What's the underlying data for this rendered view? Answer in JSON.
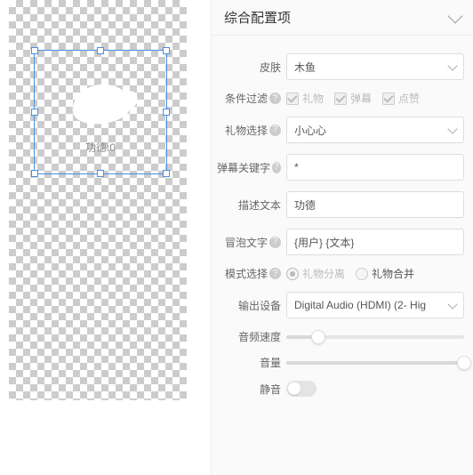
{
  "canvas": {
    "label": "功德:0"
  },
  "panel": {
    "title": "综合配置项",
    "skin": {
      "label": "皮肤",
      "value": "木鱼"
    },
    "filter": {
      "label": "条件过滤",
      "opts": [
        {
          "label": "礼物",
          "checked": true
        },
        {
          "label": "弹幕",
          "checked": true
        },
        {
          "label": "点赞",
          "checked": true
        }
      ]
    },
    "gift": {
      "label": "礼物选择",
      "value": "小心心"
    },
    "keyword": {
      "label": "弹幕关键字",
      "value": "*"
    },
    "desc": {
      "label": "描述文本",
      "value": "功德"
    },
    "bubble": {
      "label": "冒泡文字",
      "value": "{用户} {文本}"
    },
    "mode": {
      "label": "模式选择",
      "opts": [
        {
          "label": "礼物分离",
          "selected": true,
          "disabled": true
        },
        {
          "label": "礼物合并",
          "selected": false,
          "disabled": false
        }
      ]
    },
    "output": {
      "label": "输出设备",
      "value": "Digital Audio (HDMI) (2- Hig"
    },
    "speed": {
      "label": "音频速度",
      "pct": 18
    },
    "volume": {
      "label": "音量",
      "pct": 100
    },
    "mute": {
      "label": "静音",
      "on": false
    }
  }
}
